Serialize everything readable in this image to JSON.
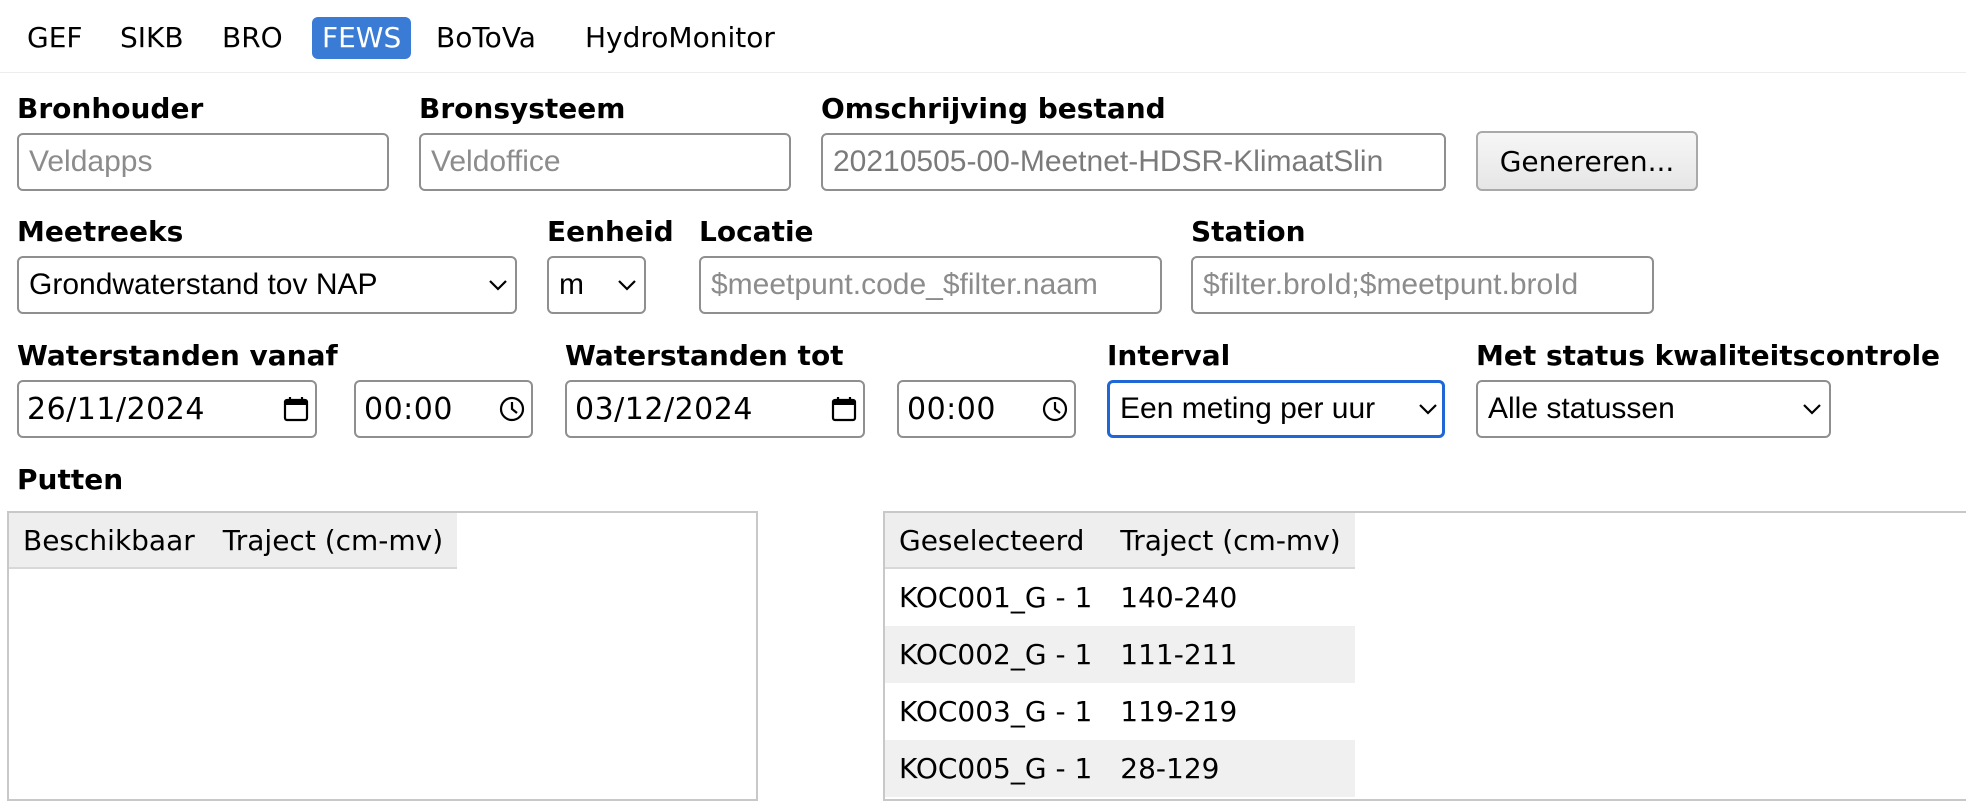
{
  "tabs": [
    "GEF",
    "SIKB",
    "BRO",
    "FEWS",
    "BoToVa",
    "HydroMonitor"
  ],
  "active_tab": "FEWS",
  "form": {
    "bronhouder": {
      "label": "Bronhouder",
      "placeholder": "Veldapps"
    },
    "bronsysteem": {
      "label": "Bronsysteem",
      "placeholder": "Veldoffice"
    },
    "omschrijving": {
      "label": "Omschrijving bestand",
      "value": "20210505-00-Meetnet-HDSR-KlimaatSlin"
    },
    "genereren_label": "Genereren...",
    "meetreeks": {
      "label": "Meetreeks",
      "value": "Grondwaterstand tov NAP"
    },
    "eenheid": {
      "label": "Eenheid",
      "value": "m"
    },
    "locatie": {
      "label": "Locatie",
      "placeholder": "$meetpunt.code_$filter.naam"
    },
    "station": {
      "label": "Station",
      "placeholder": "$filter.broId;$meetpunt.broId"
    },
    "vanaf": {
      "label": "Waterstanden vanaf",
      "date": "26/11/2024",
      "time": "00:00"
    },
    "tot": {
      "label": "Waterstanden tot",
      "date": "03/12/2024",
      "time": "00:00"
    },
    "interval": {
      "label": "Interval",
      "value": "Een meting per uur"
    },
    "status": {
      "label": "Met status kwaliteitscontrole",
      "value": "Alle statussen"
    }
  },
  "putten": {
    "label": "Putten",
    "available": {
      "headers": [
        "Beschikbaar",
        "Traject (cm-mv)"
      ],
      "rows": []
    },
    "selected": {
      "headers": [
        "Geselecteerd",
        "Traject (cm-mv)"
      ],
      "rows": [
        {
          "name": "KOC001_G - 1",
          "traject": "140-240"
        },
        {
          "name": "KOC002_G - 1",
          "traject": "111-211"
        },
        {
          "name": "KOC003_G - 1",
          "traject": "119-219"
        },
        {
          "name": "KOC005_G - 1",
          "traject": "28-129"
        }
      ]
    }
  },
  "colors": {
    "accent": "#3a7bd5",
    "focus": "#1f66d6"
  }
}
